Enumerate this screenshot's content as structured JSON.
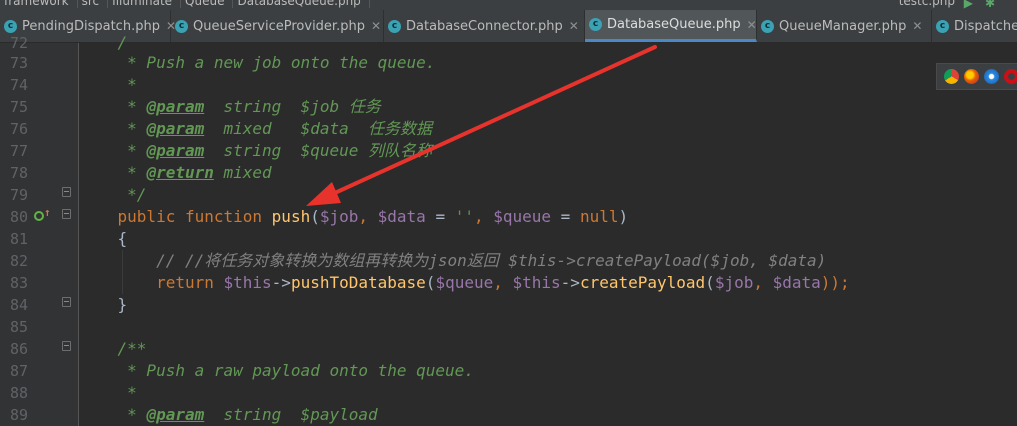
{
  "breadcrumb": {
    "items": [
      "framework",
      "src",
      "Illuminate",
      "Queue",
      "DatabaseQueue.php"
    ],
    "run_config": "testc.php"
  },
  "tabs": [
    {
      "label": "PendingDispatch.php",
      "icon": "php-class-icon",
      "active": false
    },
    {
      "label": "QueueServiceProvider.php",
      "icon": "php-class-icon",
      "active": false
    },
    {
      "label": "DatabaseConnector.php",
      "icon": "php-class-icon",
      "active": false
    },
    {
      "label": "DatabaseQueue.php",
      "icon": "php-class-icon",
      "active": true
    },
    {
      "label": "QueueManager.php",
      "icon": "php-class-icon",
      "active": false
    },
    {
      "label": "Dispatcher.php",
      "icon": "php-class-icon",
      "active": false
    }
  ],
  "gutter": {
    "line_numbers": [
      "72",
      "73",
      "74",
      "75",
      "76",
      "77",
      "78",
      "79",
      "80",
      "81",
      "82",
      "83",
      "84",
      "85",
      "86",
      "87",
      "88",
      "89"
    ]
  },
  "code": {
    "l72": "    /",
    "l73_comment": "     * Push a new job onto the queue.",
    "l74_comment": "     *",
    "l75_star": "     * ",
    "l75_tag": "@param",
    "l75_rest": "  string  $job 任务",
    "l76_star": "     * ",
    "l76_tag": "@param",
    "l76_rest": "  mixed   $data  任务数据",
    "l77_star": "     * ",
    "l77_tag": "@param",
    "l77_rest": "  string  $queue 列队名称",
    "l78_star": "     * ",
    "l78_tag": "@return",
    "l78_rest": " mixed",
    "l79_comment": "     */",
    "l80_indent": "    ",
    "l80_kw_public": "public",
    "l80_sp1": " ",
    "l80_kw_function": "function",
    "l80_sp2": " ",
    "l80_fn": "push",
    "l80_p1": "(",
    "l80_v_job": "$job",
    "l80_c1": ", ",
    "l80_v_data": "$data",
    "l80_eq": " = ",
    "l80_str": "''",
    "l80_c2": ", ",
    "l80_v_queue": "$queue",
    "l80_eq2": " = ",
    "l80_null": "null",
    "l80_p2": ")",
    "l81": "    {",
    "l82_comment": "        // //将任务对象转换为数组再转换为json返回 $this->createPayload($job, $data)",
    "l83_indent": "        ",
    "l83_return": "return",
    "l83_sp": " ",
    "l83_this1": "$this",
    "l83_arrow1": "->",
    "l83_fn1": "pushToDatabase",
    "l83_p1": "(",
    "l83_queue": "$queue",
    "l83_c1": ", ",
    "l83_this2": "$this",
    "l83_arrow2": "->",
    "l83_fn2": "createPayload",
    "l83_p2": "(",
    "l83_job": "$job",
    "l83_c2": ", ",
    "l83_data": "$data",
    "l83_end": "));",
    "l84": "    }",
    "l85": "",
    "l86_comment": "    /**",
    "l87_comment": "     * Push a raw payload onto the queue.",
    "l88_comment": "     *",
    "l89_star": "     * ",
    "l89_tag": "@param",
    "l89_rest": "  string  $payload"
  },
  "browsers": [
    "chrome-icon",
    "firefox-icon",
    "safari-icon",
    "opera-icon"
  ],
  "colors": {
    "background": "#2b2b2b",
    "keyword": "#cc7832",
    "function": "#ffc66d",
    "variable": "#9876aa",
    "doc_comment": "#629755",
    "line_comment": "#808080",
    "annotation_arrow": "#e8332d"
  }
}
